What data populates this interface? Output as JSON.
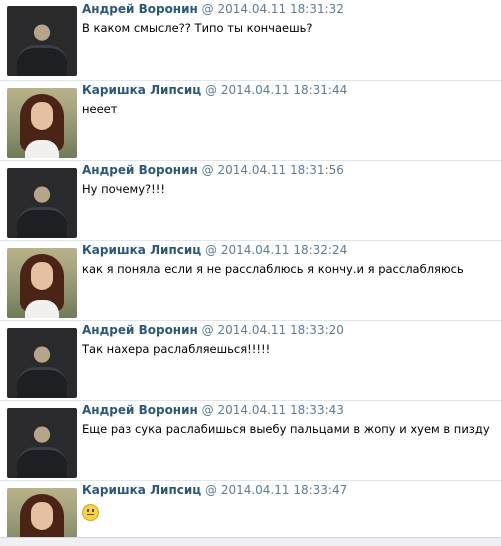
{
  "messages": [
    {
      "author": "Андрей Воронин",
      "at": "@",
      "time": "2014.04.11 18:31:32",
      "text": "В каком смысле?? Типо ты кончаешь?",
      "avatar": "male"
    },
    {
      "author": "Каришка Липсиц",
      "at": "@",
      "time": "2014.04.11 18:31:44",
      "text": "нееет",
      "avatar": "female"
    },
    {
      "author": "Андрей Воронин",
      "at": "@",
      "time": "2014.04.11 18:31:56",
      "text": "Ну почему?!!!",
      "avatar": "male"
    },
    {
      "author": "Каришка Липсиц",
      "at": "@",
      "time": "2014.04.11 18:32:24",
      "text": "как я поняла если я не расслаблюсь я кончу.и я расслабляюсь",
      "avatar": "female"
    },
    {
      "author": "Андрей Воронин",
      "at": "@",
      "time": "2014.04.11 18:33:20",
      "text": "Так нахера раслабляешься!!!!!",
      "avatar": "male"
    },
    {
      "author": "Андрей Воронин",
      "at": "@",
      "time": "2014.04.11 18:33:43",
      "text": "Еще раз сука раслабишься выебу пальцами в жопу и хуем в пизду",
      "avatar": "male"
    },
    {
      "author": "Каришка Липсиц",
      "at": "@",
      "time": "2014.04.11 18:33:47",
      "text": "",
      "emoji": "smile-emoji",
      "avatar": "female"
    }
  ],
  "colors": {
    "author": "#2b587a",
    "meta": "#5e7d99",
    "separator": "#dfe6ee"
  }
}
